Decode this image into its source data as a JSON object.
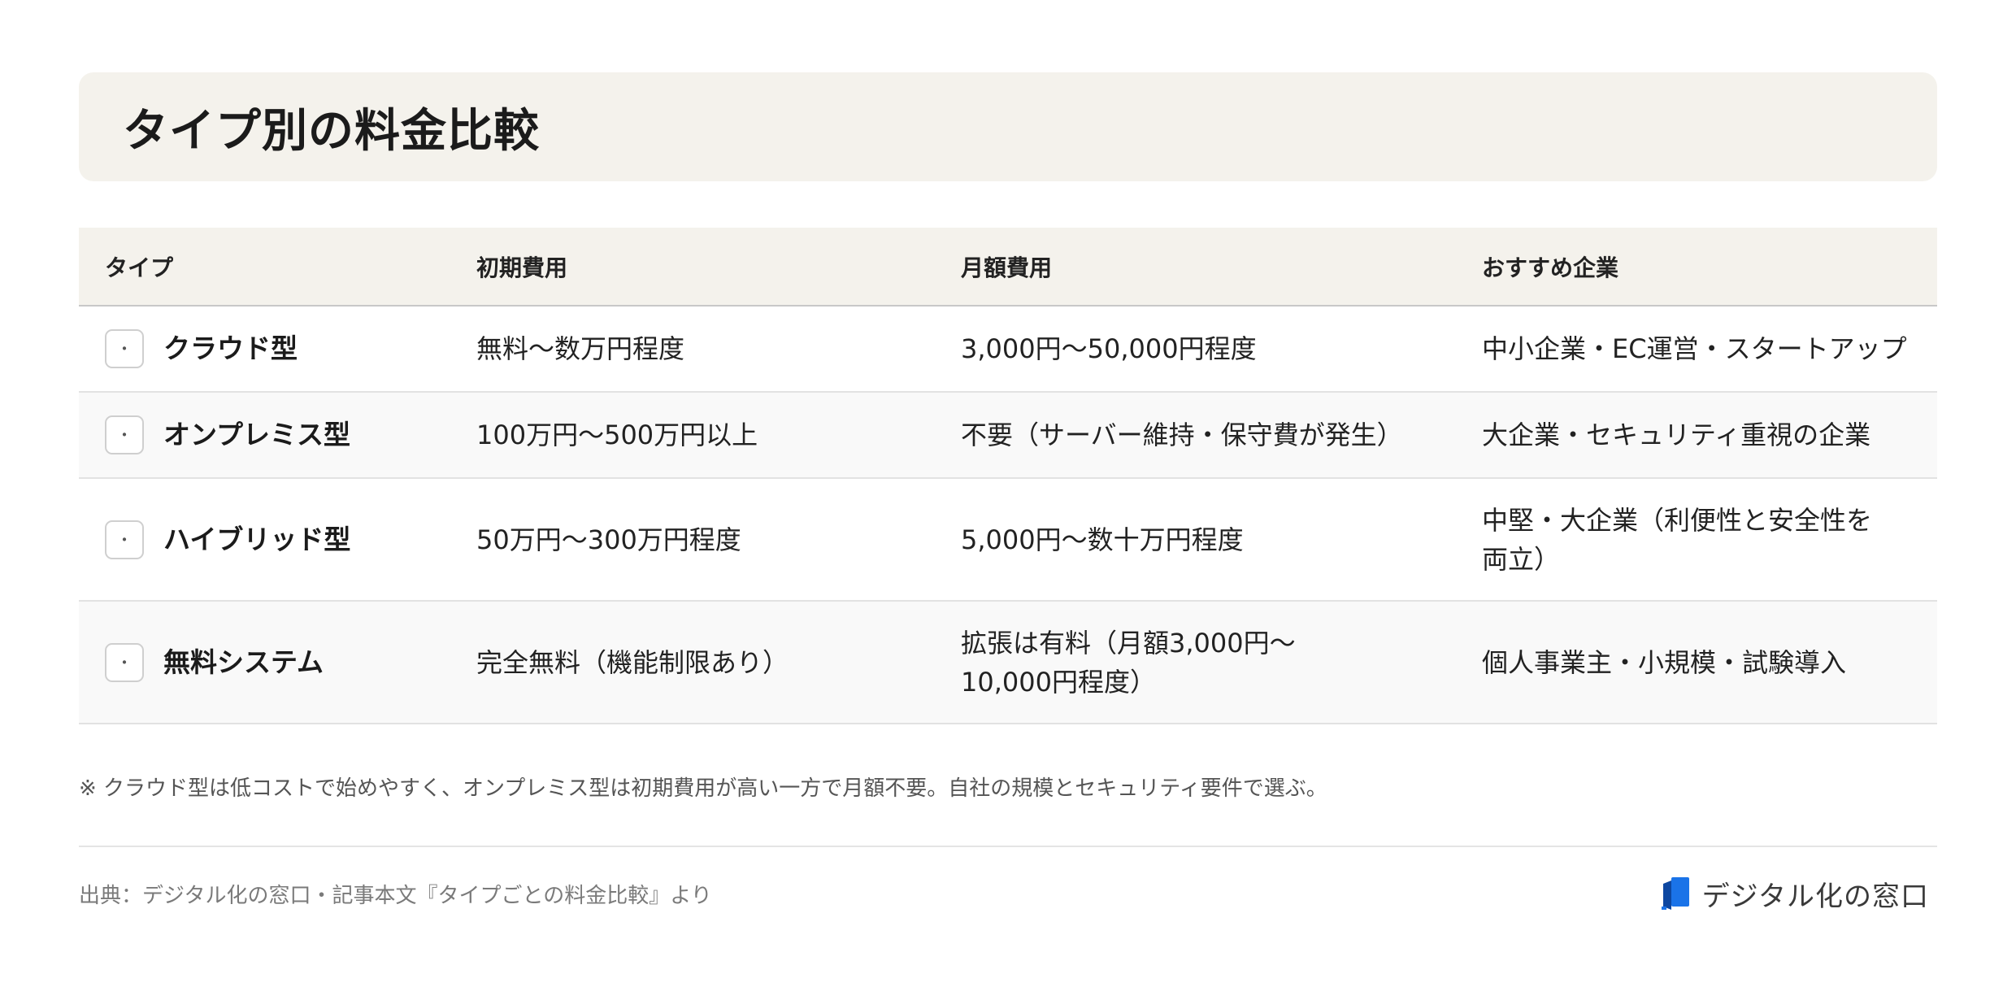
{
  "header": {
    "title": "タイプ別の料金比較"
  },
  "table": {
    "columns": [
      "タイプ",
      "初期費用",
      "月額費用",
      "おすすめ企業"
    ],
    "rows": [
      {
        "type": "クラウド型",
        "initial": "無料〜数万円程度",
        "monthly": "3,000円〜50,000円程度",
        "recommended": "中小企業・EC運営・スタートアップ"
      },
      {
        "type": "オンプレミス型",
        "initial": "100万円〜500万円以上",
        "monthly": "不要（サーバー維持・保守費が発生）",
        "recommended": "大企業・セキュリティ重視の企業"
      },
      {
        "type": "ハイブリッド型",
        "initial": "50万円〜300万円程度",
        "monthly": "5,000円〜数十万円程度",
        "recommended": "中堅・大企業（利便性と安全性を両立）"
      },
      {
        "type": "無料システム",
        "initial": "完全無料（機能制限あり）",
        "monthly": "拡張は有料（月額3,000円〜10,000円程度）",
        "recommended": "個人事業主・小規模・試験導入"
      }
    ],
    "row_icon_glyph": "・"
  },
  "note": "※ クラウド型は低コストで始めやすく、オンプレミス型は初期費用が高い一方で月額不要。自社の規模とセキュリティ要件で選ぶ。",
  "footer": {
    "source": "出典：デジタル化の窓口・記事本文『タイプごとの料金比較』より",
    "brand_name": "デジタル化の窓口",
    "brand_icon": "book-logo-icon"
  },
  "colors": {
    "header_bg": "#f4f2ec",
    "brand_blue": "#1a73e8",
    "alt_row_bg": "#f9f9f9"
  }
}
